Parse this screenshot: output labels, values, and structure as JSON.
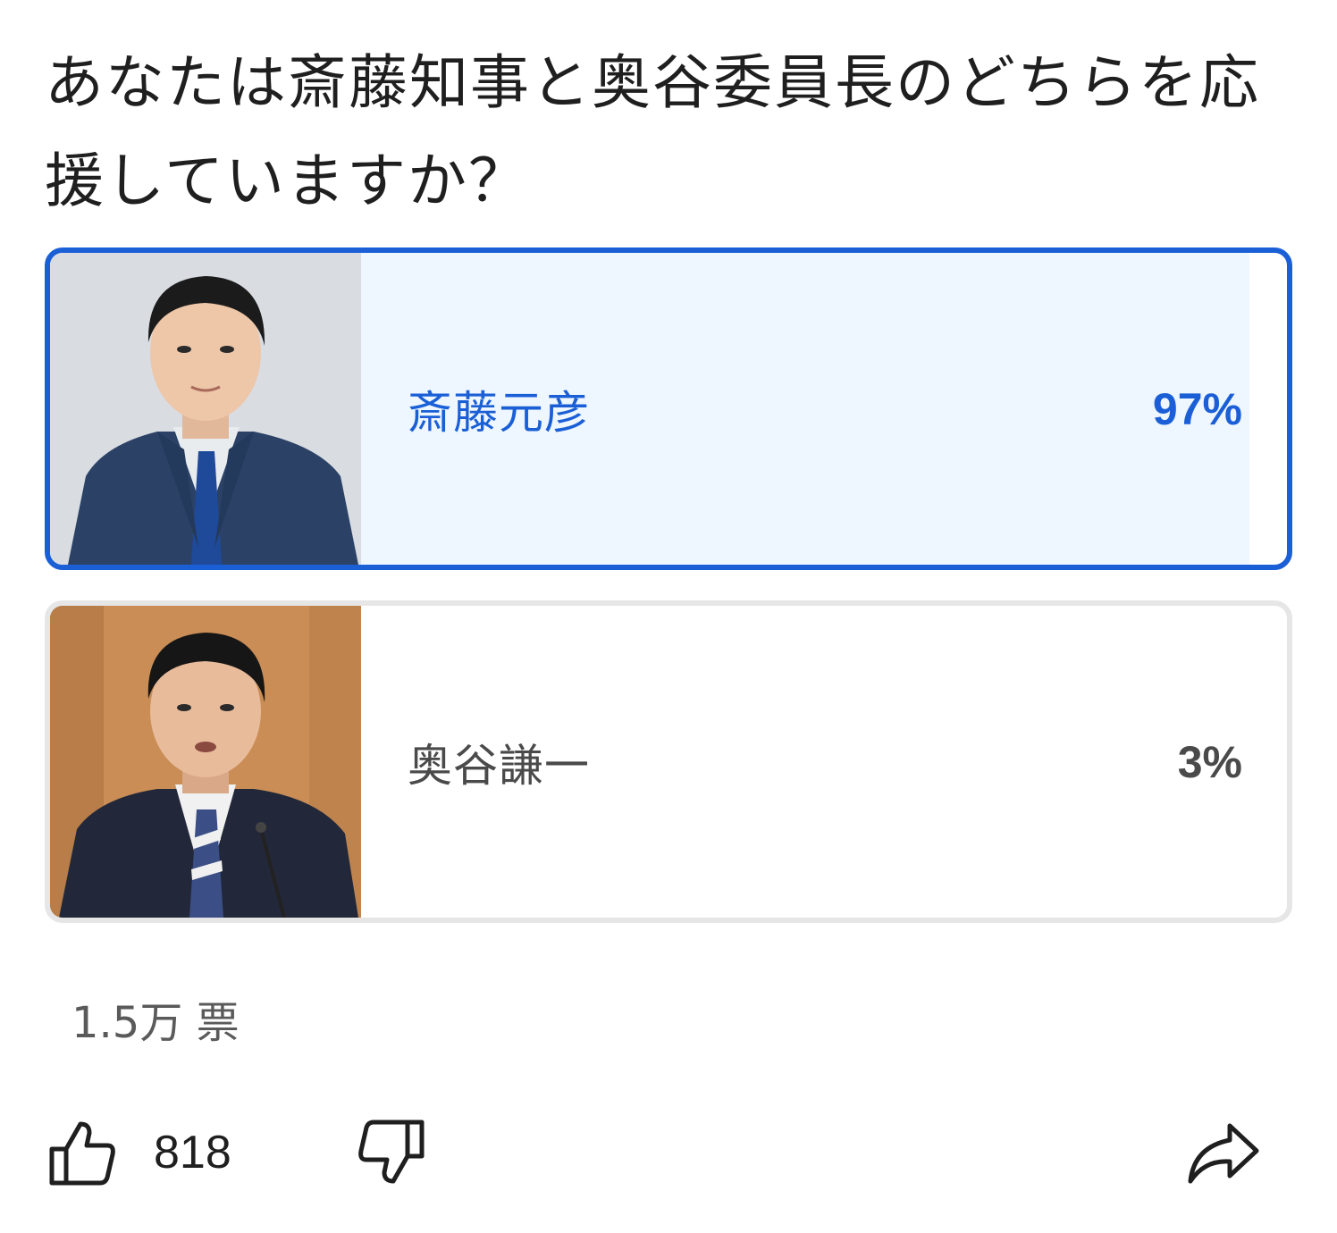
{
  "poll": {
    "question": "あなたは斎藤知事と奥谷委員長のどちらを応援していますか？",
    "options": [
      {
        "name": "斎藤元彦",
        "percent_label": "97%",
        "percent": 97,
        "selected": true
      },
      {
        "name": "奥谷謙一",
        "percent_label": "3%",
        "percent": 3,
        "selected": false
      }
    ],
    "vote_count": "1.5万 票"
  },
  "actions": {
    "like_count": "818",
    "like_icon": "thumb-up-icon",
    "dislike_icon": "thumb-down-icon",
    "share_icon": "share-icon"
  },
  "colors": {
    "accent": "#1a5fd6",
    "selected_fill": "#eef6ff",
    "unselected_fill": "#e6e6e6",
    "border_unselected": "#e6e6e6"
  }
}
